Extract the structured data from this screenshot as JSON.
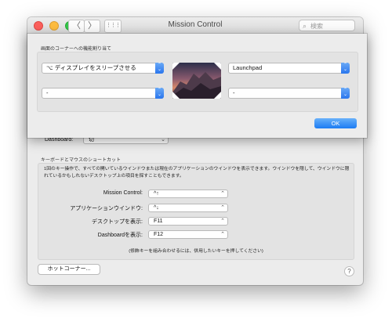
{
  "window": {
    "title": "Mission Control",
    "search_placeholder": "検索",
    "nav_back": "〈",
    "nav_forward": "〉",
    "grid": "⋮⋮⋮"
  },
  "dashboard_row": {
    "label": "Dashboard:",
    "value": "切"
  },
  "shortcuts": {
    "header": "キーボードとマウスのショートカット",
    "description": "1回のキー操作で、すべての開いているウインドウまたは現在のアプリケーションのウインドウを表示できます。ウインドウを隠して、ウインドウに隠れているかもしれないデスクトップ上の項目を探すこともできます。",
    "rows": [
      {
        "label": "Mission Control:",
        "value": "^↑"
      },
      {
        "label": "アプリケーションウインドウ:",
        "value": "^↓"
      },
      {
        "label": "デスクトップを表示:",
        "value": "F11"
      },
      {
        "label": "Dashboardを表示:",
        "value": "F12"
      }
    ],
    "hint": "(修飾キーを組み合わせるには、併用したいキーを押してください)"
  },
  "hot_corners_button": "ホットコーナー...",
  "help": "?",
  "sheet": {
    "title": "画面のコーナーへの機能割り当て",
    "top_left": "⌥ ディスプレイをスリープさせる",
    "top_right": "Launchpad",
    "bottom_left": "-",
    "bottom_right": "-",
    "ok_label": "OK"
  },
  "colors": {
    "accent": "#2a76ee",
    "window_bg": "#ececec"
  }
}
